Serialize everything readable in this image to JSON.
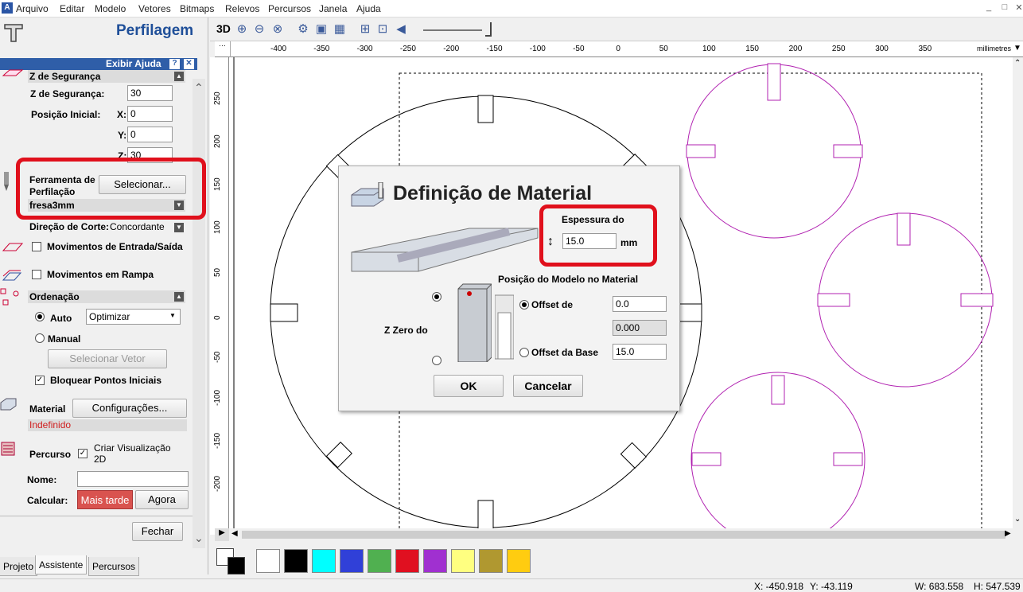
{
  "menubar": {
    "app_icon": "A",
    "items": [
      "Arquivo",
      "Editar",
      "Modelo",
      "Vetores",
      "Bitmaps",
      "Relevos",
      "Percursos",
      "Janela",
      "Ajuda"
    ],
    "window_controls": [
      "_",
      "ðŸ——",
      "✕"
    ]
  },
  "left": {
    "title": "Perfilagem",
    "help_label": "Exibir Ajuda",
    "help_q": "?",
    "help_close": "✕",
    "safe_z_header": "Z de Segurança",
    "safe_z_label": "Z de Segurança:",
    "safe_z_value": "30",
    "home_label": "Posição Inicial:",
    "x_label": "X:",
    "x_value": "0",
    "y_label": "Y:",
    "y_value": "0",
    "z_label": "Z:",
    "z_value": "30",
    "tool_label_1": "Ferramenta de",
    "tool_label_2": "Perfilação",
    "tool_select": "Selecionar...",
    "tool_name": "fresa3mm",
    "cut_dir_label": "Direção de Corte:",
    "cut_dir_value": "Concordante",
    "lead_in": "Movimentos de Entrada/Saída",
    "ramp": "Movimentos em Rampa",
    "order_header": "Ordenação",
    "auto_label": "Auto",
    "auto_value": "Optimizar",
    "manual_label": "Manual",
    "select_vector": "Selecionar Vetor",
    "lock_start": "Bloquear Pontos Iniciais",
    "lock_start_check": "✓",
    "material_label": "Material",
    "material_btn": "Configurações...",
    "material_state": "Indefinido",
    "toolpath_label": "Percurso",
    "preview_check": "✓",
    "preview_1": "Criar Visualização",
    "preview_2": "2D",
    "name_label": "Nome:",
    "name_value": "",
    "calc_label": "Calcular:",
    "later_btn": "Mais tarde",
    "now_btn": "Agora",
    "close_btn": "Fechar",
    "tabs": [
      "Projeto",
      "Assistente",
      "Percursos"
    ]
  },
  "toolbar": {
    "3d_label": "3D"
  },
  "ruler": {
    "units": "millimetres",
    "h_ticks": [
      "-400",
      "-350",
      "-300",
      "-250",
      "-200",
      "-150",
      "-100",
      "-50",
      "0",
      "50",
      "100",
      "150",
      "200",
      "250",
      "300",
      "350"
    ],
    "v_ticks": [
      "250",
      "200",
      "150",
      "100",
      "50",
      "0",
      "-50",
      "-100",
      "-150",
      "-200"
    ]
  },
  "palette": {
    "colors": [
      "#ffffff",
      "#000000",
      "#00ffff",
      "#3040d8",
      "#50b050",
      "#e01020",
      "#a030d0",
      "#ffff80",
      "#b09830",
      "#ffcc10"
    ]
  },
  "status": {
    "x": "X: -450.918",
    "y": "Y: -43.119",
    "w": "W: 683.558",
    "h": "H: 547.539"
  },
  "dialog": {
    "title": "Definição de Material",
    "thickness_label": "Espessura do",
    "thickness_value": "15.0",
    "thickness_unit": "mm",
    "position_label": "Posição do Modelo no Material",
    "zzero_label": "Z Zero do",
    "offset_label": "Offset de",
    "offset_value": "0.0",
    "offset_calc": "0.000",
    "offset_base_label": "Offset da Base",
    "offset_base_value": "15.0",
    "ok": "OK",
    "cancel": "Cancelar"
  }
}
